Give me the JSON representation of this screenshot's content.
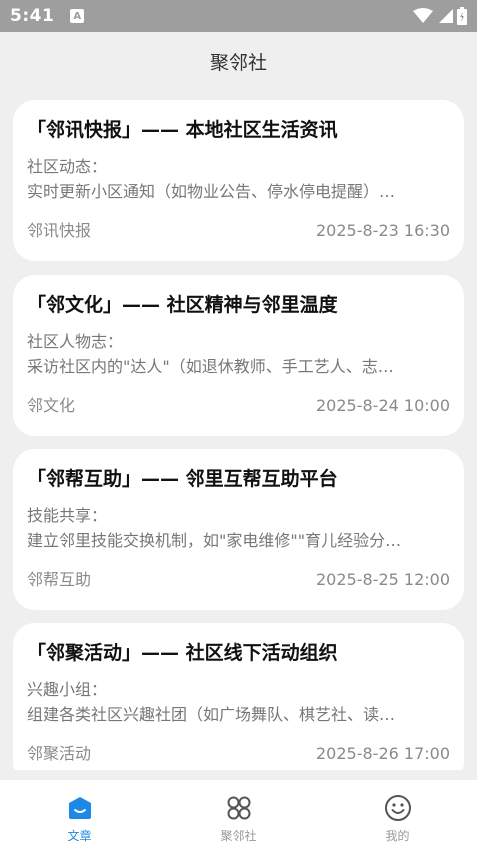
{
  "status_bar": {
    "time": "5:41",
    "notification_icon": "A"
  },
  "app": {
    "title": "聚邻社"
  },
  "articles": [
    {
      "title": "「邻讯快报」—— 本地社区生活资讯",
      "subtitle": "社区动态：",
      "description": "实时更新小区通知（如物业公告、停水停电提醒）…",
      "category": "邻讯快报",
      "date": "2025-8-23 16:30"
    },
    {
      "title": "「邻文化」—— 社区精神与邻里温度",
      "subtitle": "社区人物志：",
      "description": "采访社区内的\"达人\"（如退休教师、手工艺人、志…",
      "category": "邻文化",
      "date": "2025-8-24 10:00"
    },
    {
      "title": "「邻帮互助」—— 邻里互帮互助平台",
      "subtitle": "技能共享：",
      "description": "建立邻里技能交换机制，如\"家电维修\"\"育儿经验分…",
      "category": "邻帮互助",
      "date": "2025-8-25 12:00"
    },
    {
      "title": "「邻聚活动」—— 社区线下活动组织",
      "subtitle": "兴趣小组：",
      "description": "组建各类社区兴趣社团（如广场舞队、棋艺社、读…",
      "category": "邻聚活动",
      "date": "2025-8-26 17:00"
    }
  ],
  "tabs": [
    {
      "label": "文章",
      "icon": "article-icon",
      "active": true
    },
    {
      "label": "聚邻社",
      "icon": "community-icon",
      "active": false
    },
    {
      "label": "我的",
      "icon": "smiley-icon",
      "active": false
    }
  ],
  "colors": {
    "accent": "#1e88e5",
    "status_bar": "#9e9e9e",
    "background": "#efefef"
  }
}
